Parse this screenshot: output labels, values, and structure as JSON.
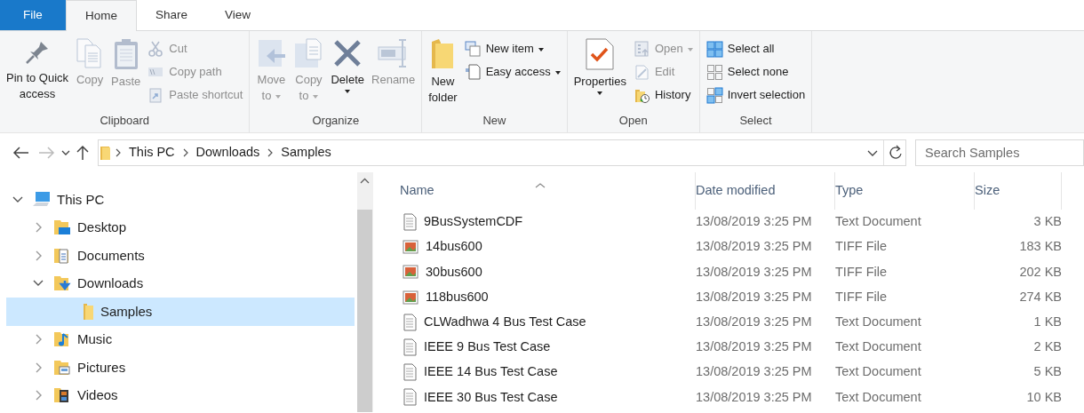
{
  "tabs": [
    {
      "label": "File",
      "kind": "file",
      "selected": false
    },
    {
      "label": "Home",
      "kind": "tab",
      "selected": true
    },
    {
      "label": "Share",
      "kind": "tab",
      "selected": false
    },
    {
      "label": "View",
      "kind": "tab",
      "selected": false
    }
  ],
  "ribbon": {
    "groups": [
      {
        "label": "Clipboard",
        "items": [
          {
            "kind": "large",
            "label": "Pin to Quick access",
            "disabled": false
          },
          {
            "kind": "large",
            "label": "Copy",
            "disabled": true
          },
          {
            "kind": "large",
            "label": "Paste",
            "disabled": true
          },
          {
            "kind": "small",
            "label": "Cut",
            "disabled": true
          },
          {
            "kind": "small",
            "label": "Copy path",
            "disabled": true
          },
          {
            "kind": "small",
            "label": "Paste shortcut",
            "disabled": true
          }
        ]
      },
      {
        "label": "Organize",
        "items": [
          {
            "kind": "large",
            "label": "Move to",
            "disabled": true,
            "dropdown": true
          },
          {
            "kind": "large",
            "label": "Copy to",
            "disabled": true,
            "dropdown": true
          },
          {
            "kind": "large",
            "label": "Delete",
            "disabled": false,
            "dropdown": true
          },
          {
            "kind": "large",
            "label": "Rename",
            "disabled": true
          }
        ]
      },
      {
        "label": "New",
        "items": [
          {
            "kind": "large",
            "label": "New folder",
            "disabled": false
          },
          {
            "kind": "small",
            "label": "New item",
            "disabled": false,
            "dropdown": true
          },
          {
            "kind": "small",
            "label": "Easy access",
            "disabled": false,
            "dropdown": true
          }
        ]
      },
      {
        "label": "Open",
        "items": [
          {
            "kind": "large",
            "label": "Properties",
            "disabled": false,
            "dropdown": true
          },
          {
            "kind": "small",
            "label": "Open",
            "disabled": true,
            "dropdown": true
          },
          {
            "kind": "small",
            "label": "Edit",
            "disabled": true
          },
          {
            "kind": "small",
            "label": "History",
            "disabled": false
          }
        ]
      },
      {
        "label": "Select",
        "items": [
          {
            "kind": "small",
            "label": "Select all",
            "disabled": false
          },
          {
            "kind": "small",
            "label": "Select none",
            "disabled": false
          },
          {
            "kind": "small",
            "label": "Invert selection",
            "disabled": false
          }
        ]
      }
    ]
  },
  "address_bar": {
    "breadcrumbs": [
      "This PC",
      "Downloads",
      "Samples"
    ],
    "forward_disabled": true
  },
  "search": {
    "placeholder": "Search Samples"
  },
  "navigation": {
    "items": [
      {
        "label": "This PC",
        "kind": "computer",
        "expandable": true,
        "expanded": true,
        "selected": false,
        "children": [
          {
            "label": "Desktop",
            "kind": "desktop",
            "expandable": true,
            "expanded": false,
            "selected": false
          },
          {
            "label": "Documents",
            "kind": "documents",
            "expandable": true,
            "expanded": false,
            "selected": false
          },
          {
            "label": "Downloads",
            "kind": "downloads",
            "expandable": true,
            "expanded": true,
            "selected": false,
            "children": [
              {
                "label": "Samples",
                "kind": "folder",
                "expandable": false,
                "expanded": false,
                "selected": true
              }
            ]
          },
          {
            "label": "Music",
            "kind": "music",
            "expandable": true,
            "expanded": false,
            "selected": false
          },
          {
            "label": "Pictures",
            "kind": "pictures",
            "expandable": true,
            "expanded": false,
            "selected": false
          },
          {
            "label": "Videos",
            "kind": "videos",
            "expandable": true,
            "expanded": false,
            "selected": false
          }
        ]
      }
    ]
  },
  "file_list": {
    "columns": [
      {
        "label": "Name",
        "sorted": true
      },
      {
        "label": "Date modified",
        "sorted": false
      },
      {
        "label": "Type",
        "sorted": false
      },
      {
        "label": "Size",
        "sorted": false
      }
    ],
    "rows": [
      {
        "kind": "text",
        "name": "9BusSystemCDF",
        "date": "13/08/2019 3:25 PM",
        "type": "Text Document",
        "size": "3 KB"
      },
      {
        "kind": "image",
        "name": "14bus600",
        "date": "13/08/2019 3:25 PM",
        "type": "TIFF File",
        "size": "183 KB"
      },
      {
        "kind": "image",
        "name": "30bus600",
        "date": "13/08/2019 3:25 PM",
        "type": "TIFF File",
        "size": "202 KB"
      },
      {
        "kind": "image",
        "name": "118bus600",
        "date": "13/08/2019 3:25 PM",
        "type": "TIFF File",
        "size": "274 KB"
      },
      {
        "kind": "text",
        "name": "CLWadhwa 4 Bus Test Case",
        "date": "13/08/2019 3:25 PM",
        "type": "Text Document",
        "size": "1 KB"
      },
      {
        "kind": "text",
        "name": "IEEE 9 Bus Test Case",
        "date": "13/08/2019 3:25 PM",
        "type": "Text Document",
        "size": "2 KB"
      },
      {
        "kind": "text",
        "name": "IEEE 14 Bus Test Case",
        "date": "13/08/2019 3:25 PM",
        "type": "Text Document",
        "size": "5 KB"
      },
      {
        "kind": "text",
        "name": "IEEE 30 Bus Test Case",
        "date": "13/08/2019 3:25 PM",
        "type": "Text Document",
        "size": "10 KB"
      }
    ]
  }
}
